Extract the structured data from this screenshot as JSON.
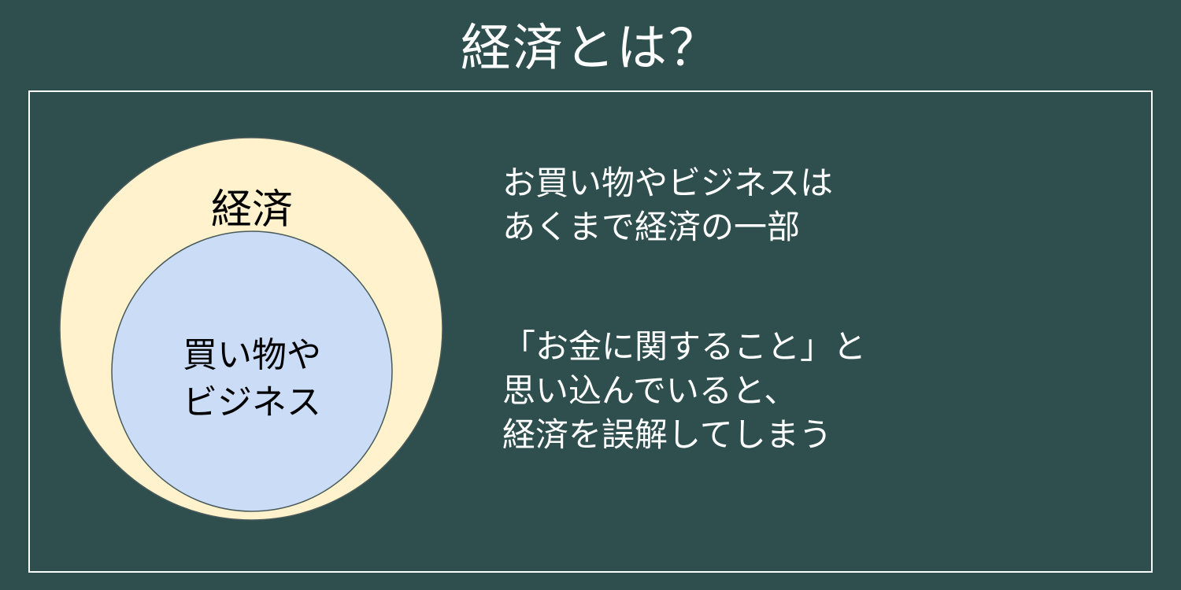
{
  "colors": {
    "background": "#2f4f4f",
    "text_light": "#ffffff",
    "text_dark": "#000000",
    "outer_circle_fill": "#fff2cc",
    "inner_circle_fill": "#cadcf6",
    "circle_stroke": "#4a5a5a",
    "frame_border": "#ffffff"
  },
  "title": "経済とは？",
  "diagram": {
    "outer_label": "経済",
    "inner_label_line1": "買い物や",
    "inner_label_line2": "ビジネス"
  },
  "explanation": {
    "block1": [
      "お買い物やビジネスは",
      "あくまで経済の一部"
    ],
    "block2": [
      "「お金に関すること」と",
      "思い込んでいると、",
      "経済を誤解してしまう"
    ]
  }
}
